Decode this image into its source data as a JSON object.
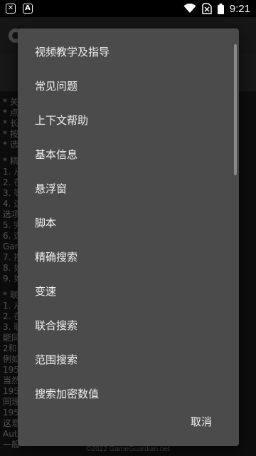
{
  "status_bar": {
    "time": "9:21",
    "notif_icons": [
      "close-box-icon",
      "a-box-icon"
    ],
    "icons": [
      "wifi-icon",
      "no-sim-icon",
      "battery-icon"
    ]
  },
  "background": {
    "footer": "©2022 GameGuardian.net",
    "lines": [
      "* 关",
      "* 点",
      "* 长",
      "* 按",
      "* 选",
      "* 精",
      "1. 从",
      "2. 在",
      "3. 等",
      "4. 这                                                          他",
      "选项",
      "5. 完",
      "6. 选",
      "Gam",
      "7. 按",
      "8. 如",
      "9. 如",
      "* 联",
      "1. 从",
      "2. 在",
      "3. 联",
      "能同                                                          在",
      "2和",
      "例如",
      "195",
      "当然",
      "195",
      "同理",
      "195",
      "这意                                                       8的",
      "Auto",
      "一般"
    ]
  },
  "dialog": {
    "items": [
      "视频教学及指导",
      "常见问题",
      "上下文帮助",
      "基本信息",
      "悬浮窗",
      "脚本",
      "精确搜索",
      "变速",
      "联合搜索",
      "范围搜索",
      "搜索加密数值"
    ],
    "cancel_label": "取消"
  }
}
